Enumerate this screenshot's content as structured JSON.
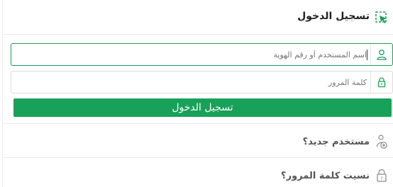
{
  "header": {
    "title": "تسجيل الدخول",
    "icon": "login-cursor-icon"
  },
  "form": {
    "username_placeholder": "اسم المستخدم أو رقم الهوية",
    "username_value": "",
    "username_icon": "user-icon",
    "password_placeholder": "كلمة المرور",
    "password_value": "",
    "password_icon": "lock-icon",
    "submit_label": "تسجيل الدخول"
  },
  "links": {
    "new_user": "مستخدم جديد؟",
    "new_user_icon": "add-user-icon",
    "forgot_password": "نسيت كلمة المرور؟",
    "forgot_password_icon": "lock-question-icon"
  },
  "colors": {
    "accent": "#18a159",
    "border": "#dcdcdc",
    "active_border": "#19a05a"
  }
}
